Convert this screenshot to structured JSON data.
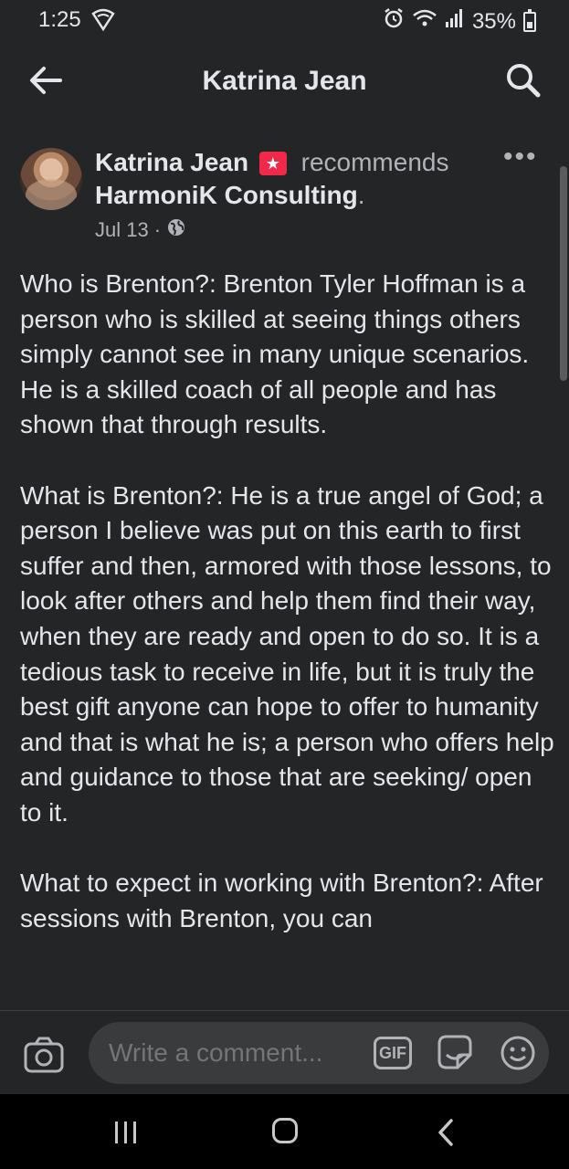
{
  "status_bar": {
    "time": "1:25",
    "battery": "35%"
  },
  "header": {
    "title": "Katrina Jean"
  },
  "post": {
    "author": "Katrina Jean",
    "badge_icon": "recommendation-star-icon",
    "verb": "recommends",
    "page": "HarmoniK Consulting",
    "page_suffix": ".",
    "date": "Jul 13",
    "separator": "·",
    "privacy_icon": "globe-icon",
    "paragraphs": [
      "Who is Brenton?: Brenton Tyler Hoffman is a person who is skilled at seeing things others simply cannot see in many unique scenarios. He is a skilled coach of all people and has shown that through results.",
      "What is Brenton?: He is a true angel of God; a person I believe was put on this earth to first suffer and then, armored with those lessons, to look after others and help them find their way, when they are ready and open to do so. It is a tedious task to receive in life, but it is truly the best gift anyone can hope to offer to humanity and that is what he is; a person who offers help and guidance to those that are seeking/ open to it.",
      "What to expect in working with Brenton?: After sessions with Brenton, you can"
    ]
  },
  "comment_bar": {
    "placeholder": "Write a comment...",
    "gif_label": "GIF"
  },
  "colors": {
    "background": "#242526",
    "text": "#e4e6eb",
    "secondary_text": "#b0b3b8",
    "input_bg": "#3a3b3c",
    "badge": "#f02849"
  }
}
